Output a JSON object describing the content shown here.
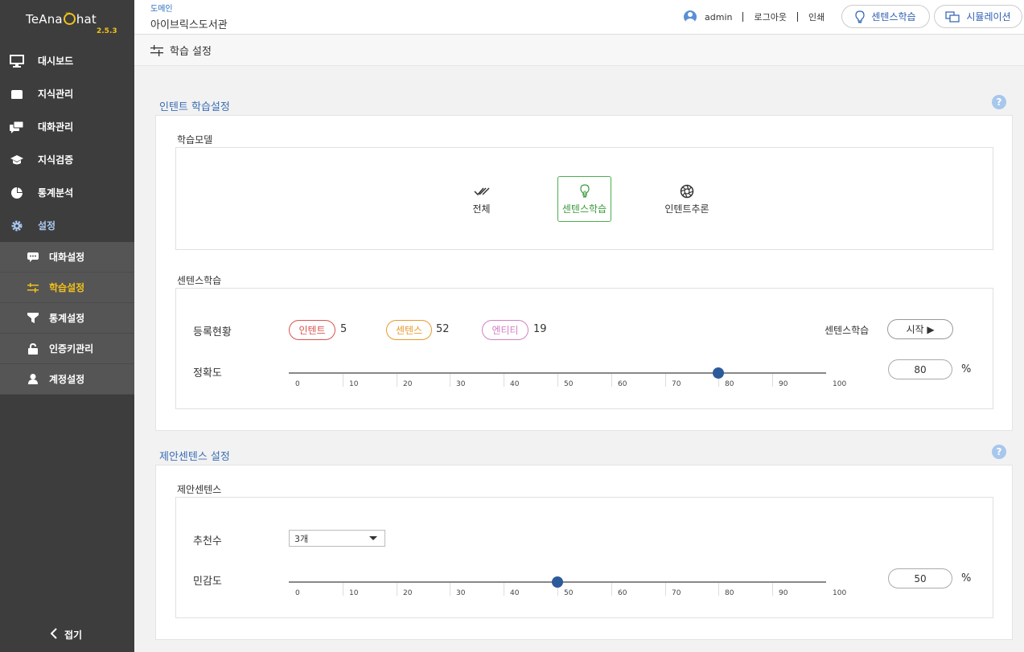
{
  "app": {
    "brand_prefix": "TeAna",
    "brand_suffix": "hat",
    "version": "2.5.3"
  },
  "sidebar": {
    "items": [
      {
        "label": "대시보드",
        "icon": "monitor-icon"
      },
      {
        "label": "지식관리",
        "icon": "folder-icon"
      },
      {
        "label": "대화관리",
        "icon": "chat-icon"
      },
      {
        "label": "지식검증",
        "icon": "graduation-cap-icon"
      },
      {
        "label": "통계분석",
        "icon": "pie-chart-icon"
      },
      {
        "label": "설정",
        "icon": "gear-icon"
      }
    ],
    "subitems": [
      {
        "label": "대화설정",
        "icon": "speech-bubble-icon"
      },
      {
        "label": "학습설정",
        "icon": "sliders-icon"
      },
      {
        "label": "통계설정",
        "icon": "filter-icon"
      },
      {
        "label": "인증키관리",
        "icon": "lock-icon"
      },
      {
        "label": "계정설정",
        "icon": "user-icon"
      }
    ],
    "collapse_label": "접기"
  },
  "header": {
    "domain_label": "도메인",
    "domain_name": "아이브릭스도서관",
    "username": "admin",
    "logout": "로그아웃",
    "print": "인쇄",
    "learn_button": "센텐스학습",
    "simulation_button": "시뮬레이션"
  },
  "page": {
    "title": "학습 설정"
  },
  "intent_section": {
    "title": "인텐트 학습설정",
    "model_label": "학습모델",
    "models": [
      {
        "label": "전체",
        "icon": "double-check-icon"
      },
      {
        "label": "센텐스학습",
        "icon": "lightbulb-icon"
      },
      {
        "label": "인텐트추론",
        "icon": "aperture-icon"
      }
    ],
    "selected_model": "센텐스학습",
    "sentence_label": "센텐스학습",
    "status_label": "등록현황",
    "badges": [
      {
        "label": "인텐트",
        "count": "5",
        "color": "#d9534f"
      },
      {
        "label": "센텐스",
        "count": "52",
        "color": "#e89a2c"
      },
      {
        "label": "엔티티",
        "count": "19",
        "color": "#d47fc4"
      }
    ],
    "run_label": "센텐스학습",
    "start_button": "시작 ▶",
    "accuracy_label": "정확도",
    "accuracy_value": "80",
    "accuracy_thumb": 80,
    "percent_sign": "%"
  },
  "suggest_section": {
    "title": "제안센텐스 설정",
    "box_label": "제안센텐스",
    "recommend_label": "추천수",
    "recommend_value": "3개",
    "sensitivity_label": "민감도",
    "sensitivity_value": "50",
    "sensitivity_thumb": 50,
    "percent_sign": "%"
  },
  "slider_ticks": [
    "0",
    "10",
    "20",
    "30",
    "40",
    "50",
    "60",
    "70",
    "80",
    "90",
    "100"
  ],
  "help_glyph": "?",
  "colors": {
    "sidebar_bg": "#3d3d3d",
    "accent_yellow": "#f2c11a",
    "link_blue": "#3a6db5",
    "thumb_blue": "#2d5a9a",
    "selected_green": "#4caf50"
  }
}
